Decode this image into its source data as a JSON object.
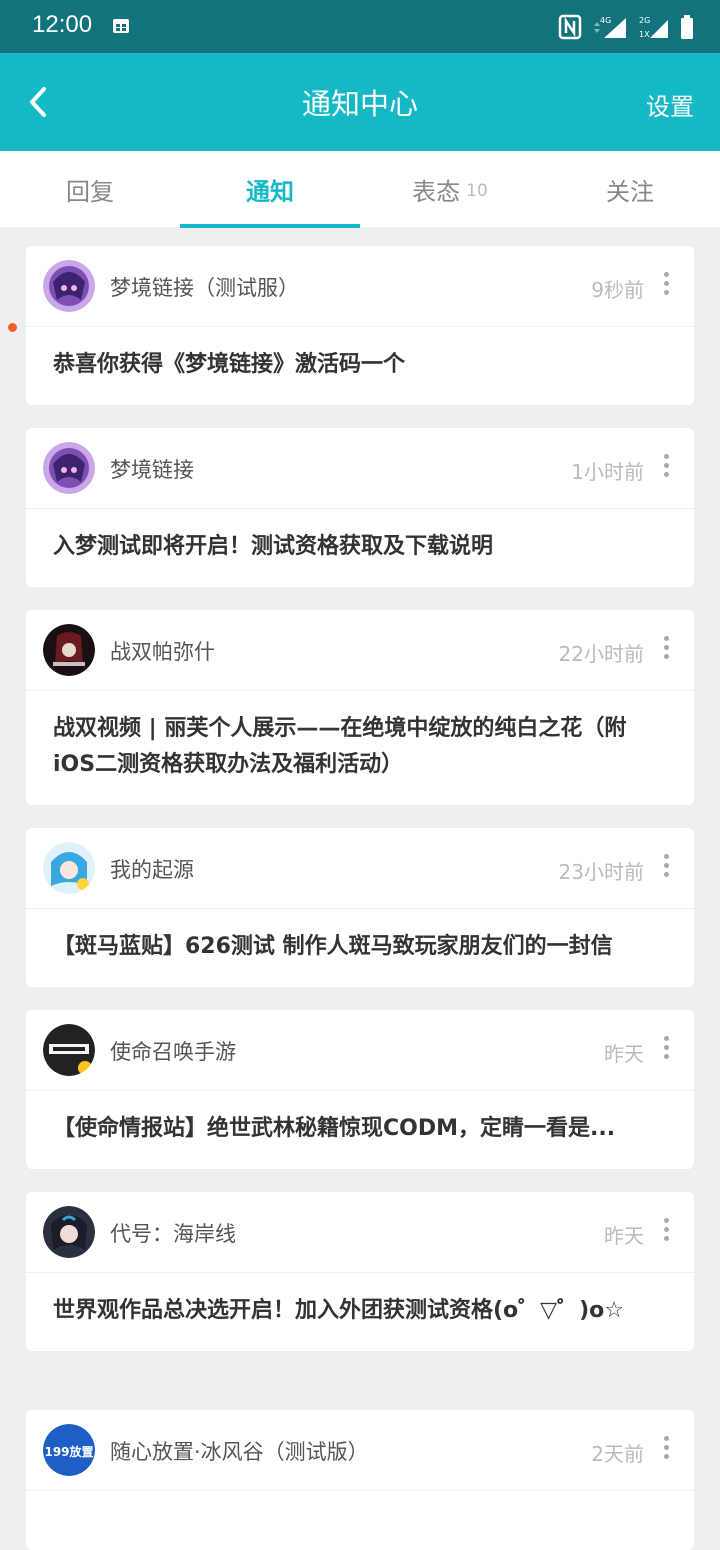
{
  "status_bar": {
    "time": "12:00",
    "network_top": "4G",
    "network_2g": "2G",
    "network_1x": "1X"
  },
  "header": {
    "title": "通知中心",
    "settings_label": "设置"
  },
  "tabs": [
    {
      "label": "回复"
    },
    {
      "label": "通知"
    },
    {
      "label": "表态",
      "badge": "10"
    },
    {
      "label": "关注"
    }
  ],
  "notifications": [
    {
      "name": "梦境链接（测试服）",
      "time": "9秒前",
      "text": "恭喜你获得《梦境链接》激活码一个"
    },
    {
      "name": "梦境链接",
      "time": "1小时前",
      "text": "入梦测试即将开启！测试资格获取及下载说明"
    },
    {
      "name": "战双帕弥什",
      "time": "22小时前",
      "text": "战双视频 | 丽芙个人展示——在绝境中绽放的纯白之花（附iOS二测资格获取办法及福利活动）"
    },
    {
      "name": "我的起源",
      "time": "23小时前",
      "text": "【斑马蓝贴】626测试 制作人斑马致玩家朋友们的一封信"
    },
    {
      "name": "使命召唤手游",
      "time": "昨天",
      "text": "【使命情报站】绝世武林秘籍惊现CODM，定睛一看是..."
    },
    {
      "name": "代号：海岸线",
      "time": "昨天",
      "text": "世界观作品总决选开启！加入外团获测试资格(o゜▽゜)o☆"
    },
    {
      "name": "随心放置·冰风谷（测试版）",
      "time": "2天前",
      "text": ""
    }
  ],
  "avatars": {
    "game_7_avatar_text": "199放置"
  }
}
